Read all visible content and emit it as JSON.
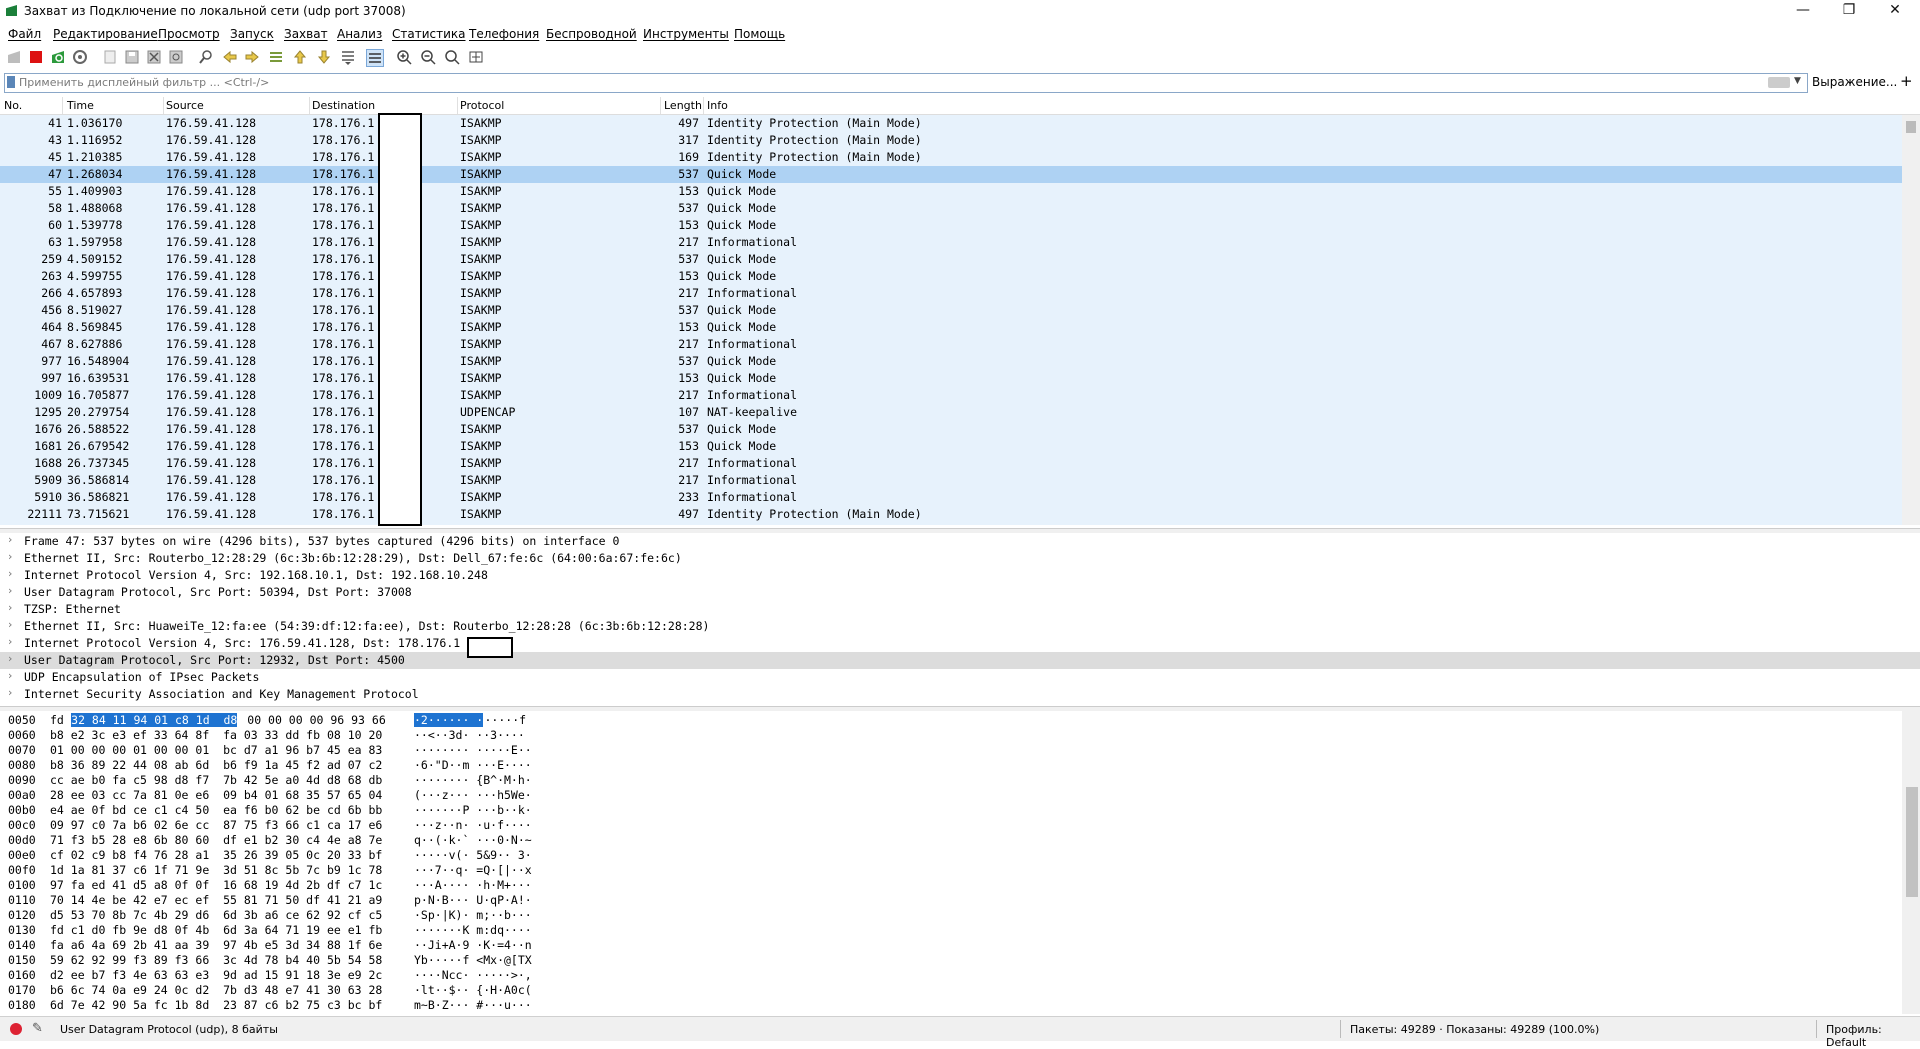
{
  "window": {
    "title": "Захват из Подключение по локальной сети (udp port 37008)",
    "minimize": "—",
    "maximize": "❐",
    "close": "✕"
  },
  "menu": [
    "Файл",
    "Редактирование",
    "Просмотр",
    "Запуск",
    "Захват",
    "Анализ",
    "Статистика",
    "Телефония",
    "Беспроводной",
    "Инструменты",
    "Помощь"
  ],
  "filter": {
    "placeholder": "Применить дисплейный фильтр ... <Ctrl-/>",
    "expression_label": "Выражение...",
    "add_label": "+"
  },
  "packet_list": {
    "columns": [
      "No.",
      "Time",
      "Source",
      "Destination",
      "Protocol",
      "Length",
      "Info"
    ],
    "selected_index": 3,
    "rows": [
      {
        "no": "41",
        "time": "1.036170",
        "src": "176.59.41.128",
        "dst": "178.176.1",
        "proto": "ISAKMP",
        "len": "497",
        "info": "Identity Protection (Main Mode)"
      },
      {
        "no": "43",
        "time": "1.116952",
        "src": "176.59.41.128",
        "dst": "178.176.1",
        "proto": "ISAKMP",
        "len": "317",
        "info": "Identity Protection (Main Mode)"
      },
      {
        "no": "45",
        "time": "1.210385",
        "src": "176.59.41.128",
        "dst": "178.176.1",
        "proto": "ISAKMP",
        "len": "169",
        "info": "Identity Protection (Main Mode)"
      },
      {
        "no": "47",
        "time": "1.268034",
        "src": "176.59.41.128",
        "dst": "178.176.1",
        "proto": "ISAKMP",
        "len": "537",
        "info": "Quick Mode"
      },
      {
        "no": "55",
        "time": "1.409903",
        "src": "176.59.41.128",
        "dst": "178.176.1",
        "proto": "ISAKMP",
        "len": "153",
        "info": "Quick Mode"
      },
      {
        "no": "58",
        "time": "1.488068",
        "src": "176.59.41.128",
        "dst": "178.176.1",
        "proto": "ISAKMP",
        "len": "537",
        "info": "Quick Mode"
      },
      {
        "no": "60",
        "time": "1.539778",
        "src": "176.59.41.128",
        "dst": "178.176.1",
        "proto": "ISAKMP",
        "len": "153",
        "info": "Quick Mode"
      },
      {
        "no": "63",
        "time": "1.597958",
        "src": "176.59.41.128",
        "dst": "178.176.1",
        "proto": "ISAKMP",
        "len": "217",
        "info": "Informational"
      },
      {
        "no": "259",
        "time": "4.509152",
        "src": "176.59.41.128",
        "dst": "178.176.1",
        "proto": "ISAKMP",
        "len": "537",
        "info": "Quick Mode"
      },
      {
        "no": "263",
        "time": "4.599755",
        "src": "176.59.41.128",
        "dst": "178.176.1",
        "proto": "ISAKMP",
        "len": "153",
        "info": "Quick Mode"
      },
      {
        "no": "266",
        "time": "4.657893",
        "src": "176.59.41.128",
        "dst": "178.176.1",
        "proto": "ISAKMP",
        "len": "217",
        "info": "Informational"
      },
      {
        "no": "456",
        "time": "8.519027",
        "src": "176.59.41.128",
        "dst": "178.176.1",
        "proto": "ISAKMP",
        "len": "537",
        "info": "Quick Mode"
      },
      {
        "no": "464",
        "time": "8.569845",
        "src": "176.59.41.128",
        "dst": "178.176.1",
        "proto": "ISAKMP",
        "len": "153",
        "info": "Quick Mode"
      },
      {
        "no": "467",
        "time": "8.627886",
        "src": "176.59.41.128",
        "dst": "178.176.1",
        "proto": "ISAKMP",
        "len": "217",
        "info": "Informational"
      },
      {
        "no": "977",
        "time": "16.548904",
        "src": "176.59.41.128",
        "dst": "178.176.1",
        "proto": "ISAKMP",
        "len": "537",
        "info": "Quick Mode"
      },
      {
        "no": "997",
        "time": "16.639531",
        "src": "176.59.41.128",
        "dst": "178.176.1",
        "proto": "ISAKMP",
        "len": "153",
        "info": "Quick Mode"
      },
      {
        "no": "1009",
        "time": "16.705877",
        "src": "176.59.41.128",
        "dst": "178.176.1",
        "proto": "ISAKMP",
        "len": "217",
        "info": "Informational"
      },
      {
        "no": "1295",
        "time": "20.279754",
        "src": "176.59.41.128",
        "dst": "178.176.1",
        "proto": "UDPENCAP",
        "len": "107",
        "info": "NAT-keepalive"
      },
      {
        "no": "1676",
        "time": "26.588522",
        "src": "176.59.41.128",
        "dst": "178.176.1",
        "proto": "ISAKMP",
        "len": "537",
        "info": "Quick Mode"
      },
      {
        "no": "1681",
        "time": "26.679542",
        "src": "176.59.41.128",
        "dst": "178.176.1",
        "proto": "ISAKMP",
        "len": "153",
        "info": "Quick Mode"
      },
      {
        "no": "1688",
        "time": "26.737345",
        "src": "176.59.41.128",
        "dst": "178.176.1",
        "proto": "ISAKMP",
        "len": "217",
        "info": "Informational"
      },
      {
        "no": "5909",
        "time": "36.586814",
        "src": "176.59.41.128",
        "dst": "178.176.1",
        "proto": "ISAKMP",
        "len": "217",
        "info": "Informational"
      },
      {
        "no": "5910",
        "time": "36.586821",
        "src": "176.59.41.128",
        "dst": "178.176.1",
        "proto": "ISAKMP",
        "len": "233",
        "info": "Informational"
      },
      {
        "no": "22111",
        "time": "73.715621",
        "src": "176.59.41.128",
        "dst": "178.176.1",
        "proto": "ISAKMP",
        "len": "497",
        "info": "Identity Protection (Main Mode)"
      }
    ]
  },
  "details": {
    "selected_index": 7,
    "rows": [
      "Frame 47: 537 bytes on wire (4296 bits), 537 bytes captured (4296 bits) on interface 0",
      "Ethernet II, Src: Routerbo_12:28:29 (6c:3b:6b:12:28:29), Dst: Dell_67:fe:6c (64:00:6a:67:fe:6c)",
      "Internet Protocol Version 4, Src: 192.168.10.1, Dst: 192.168.10.248",
      "User Datagram Protocol, Src Port: 50394, Dst Port: 37008",
      "TZSP: Ethernet",
      "Ethernet II, Src: HuaweiTe_12:fa:ee (54:39:df:12:fa:ee), Dst: Routerbo_12:28:28 (6c:3b:6b:12:28:28)",
      "Internet Protocol Version 4, Src: 176.59.41.128, Dst: 178.176.1",
      "User Datagram Protocol, Src Port: 12932, Dst Port: 4500",
      "UDP Encapsulation of IPsec Packets",
      "Internet Security Association and Key Management Protocol"
    ]
  },
  "hex": {
    "rows": [
      {
        "off": "0050",
        "pre": "fd ",
        "hl": "32 84 11 94 01 c8 1d  d8",
        "post": " 00 00 00 00 96 93 66",
        "apre": "",
        "ahl": "·2······ ·",
        "apost": "·····f"
      },
      {
        "off": "0060",
        "pre": "b8 e2 3c e3 ef 33 64 8f  fa 03 33 dd fb 08 10 20",
        "hl": "",
        "post": "",
        "apre": "··<··3d· ··3····",
        "ahl": "",
        "apost": ""
      },
      {
        "off": "0070",
        "pre": "01 00 00 00 01 00 00 01  bc d7 a1 96 b7 45 ea 83",
        "hl": "",
        "post": "",
        "apre": "········ ·····E··",
        "ahl": "",
        "apost": ""
      },
      {
        "off": "0080",
        "pre": "b8 36 89 22 44 08 ab 6d  b6 f9 1a 45 f2 ad 07 c2",
        "hl": "",
        "post": "",
        "apre": "·6·\"D··m ···E····",
        "ahl": "",
        "apost": ""
      },
      {
        "off": "0090",
        "pre": "cc ae b0 fa c5 98 d8 f7  7b 42 5e a0 4d d8 68 db",
        "hl": "",
        "post": "",
        "apre": "········ {B^·M·h·",
        "ahl": "",
        "apost": ""
      },
      {
        "off": "00a0",
        "pre": "28 ee 03 cc 7a 81 0e e6  09 b4 01 68 35 57 65 04",
        "hl": "",
        "post": "",
        "apre": "(···z··· ···h5We·",
        "ahl": "",
        "apost": ""
      },
      {
        "off": "00b0",
        "pre": "e4 ae 0f bd ce c1 c4 50  ea f6 b0 62 be cd 6b bb",
        "hl": "",
        "post": "",
        "apre": "·······P ···b··k·",
        "ahl": "",
        "apost": ""
      },
      {
        "off": "00c0",
        "pre": "09 97 c0 7a b6 02 6e cc  87 75 f3 66 c1 ca 17 e6",
        "hl": "",
        "post": "",
        "apre": "···z··n· ·u·f····",
        "ahl": "",
        "apost": ""
      },
      {
        "off": "00d0",
        "pre": "71 f3 b5 28 e8 6b 80 60  df e1 b2 30 c4 4e a8 7e",
        "hl": "",
        "post": "",
        "apre": "q··(·k·` ···0·N·~",
        "ahl": "",
        "apost": ""
      },
      {
        "off": "00e0",
        "pre": "cf 02 c9 b8 f4 76 28 a1  35 26 39 05 0c 20 33 bf",
        "hl": "",
        "post": "",
        "apre": "·····v(· 5&9·· 3·",
        "ahl": "",
        "apost": ""
      },
      {
        "off": "00f0",
        "pre": "1d 1a 81 37 c6 1f 71 9e  3d 51 8c 5b 7c b9 1c 78",
        "hl": "",
        "post": "",
        "apre": "···7··q· =Q·[|··x",
        "ahl": "",
        "apost": ""
      },
      {
        "off": "0100",
        "pre": "97 fa ed 41 d5 a8 0f 0f  16 68 19 4d 2b df c7 1c",
        "hl": "",
        "post": "",
        "apre": "···A···· ·h·M+···",
        "ahl": "",
        "apost": ""
      },
      {
        "off": "0110",
        "pre": "70 14 4e be 42 e7 ec ef  55 81 71 50 df 41 21 a9",
        "hl": "",
        "post": "",
        "apre": "p·N·B··· U·qP·A!·",
        "ahl": "",
        "apost": ""
      },
      {
        "off": "0120",
        "pre": "d5 53 70 8b 7c 4b 29 d6  6d 3b a6 ce 62 92 cf c5",
        "hl": "",
        "post": "",
        "apre": "·Sp·|K)· m;··b···",
        "ahl": "",
        "apost": ""
      },
      {
        "off": "0130",
        "pre": "fd c1 d0 fb 9e d8 0f 4b  6d 3a 64 71 19 ee e1 fb",
        "hl": "",
        "post": "",
        "apre": "·······K m:dq····",
        "ahl": "",
        "apost": ""
      },
      {
        "off": "0140",
        "pre": "fa a6 4a 69 2b 41 aa 39  97 4b e5 3d 34 88 1f 6e",
        "hl": "",
        "post": "",
        "apre": "··Ji+A·9 ·K·=4··n",
        "ahl": "",
        "apost": ""
      },
      {
        "off": "0150",
        "pre": "59 62 92 99 f3 89 f3 66  3c 4d 78 b4 40 5b 54 58",
        "hl": "",
        "post": "",
        "apre": "Yb·····f <Mx·@[TX",
        "ahl": "",
        "apost": ""
      },
      {
        "off": "0160",
        "pre": "d2 ee b7 f3 4e 63 63 e3  9d ad 15 91 18 3e e9 2c",
        "hl": "",
        "post": "",
        "apre": "····Ncc· ·····>·,",
        "ahl": "",
        "apost": ""
      },
      {
        "off": "0170",
        "pre": "b6 6c 74 0a e9 24 0c d2  7b d3 48 e7 41 30 63 28",
        "hl": "",
        "post": "",
        "apre": "·lt··$·· {·H·A0c(",
        "ahl": "",
        "apost": ""
      },
      {
        "off": "0180",
        "pre": "6d 7e 42 90 5a fc 1b 8d  23 87 c6 b2 75 c3 bc bf",
        "hl": "",
        "post": "",
        "apre": "m~B·Z··· #···u···",
        "ahl": "",
        "apost": ""
      }
    ]
  },
  "status": {
    "selected_field": "User Datagram Protocol (udp), 8 байты",
    "packets": "Пакеты: 49289 · Показаны: 49289 (100.0%)",
    "profile": "Профиль: Default"
  },
  "colors": {
    "row_bg": "#e7f2fc",
    "row_selected": "#aed2f3",
    "hex_highlight": "#1e73d1"
  }
}
